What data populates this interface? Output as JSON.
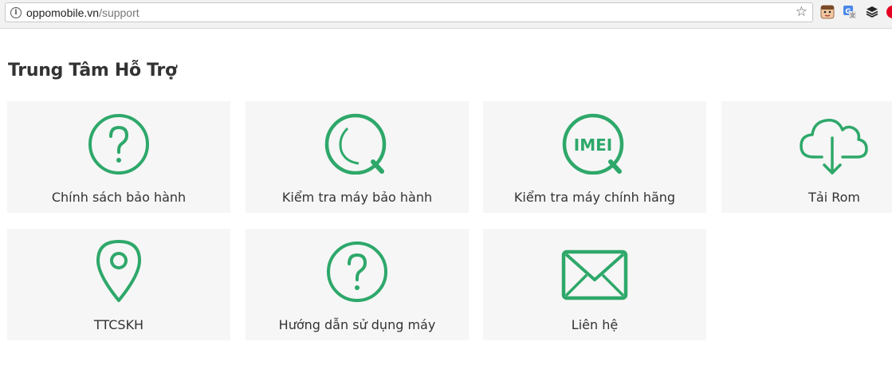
{
  "browser": {
    "url_domain": "oppomobile.vn",
    "url_path": "/support",
    "info_glyph": "i",
    "star_glyph": "☆"
  },
  "page": {
    "title": "Trung Tâm Hỗ Trợ"
  },
  "colors": {
    "accent": "#2ea86a",
    "card_bg": "#f6f6f6",
    "text": "#333333"
  },
  "cards": [
    {
      "label": "Chính sách bảo hành",
      "icon": "question-circle-icon"
    },
    {
      "label": "Kiểm tra máy bảo hành",
      "icon": "search-q-icon"
    },
    {
      "label": "Kiểm tra máy chính hãng",
      "icon": "imei-search-icon",
      "icon_text": "IMEI"
    },
    {
      "label": "Tải Rom",
      "icon": "cloud-download-icon"
    },
    {
      "label": "TTCSKH",
      "icon": "map-pin-icon"
    },
    {
      "label": "Hướng dẫn sử dụng máy",
      "icon": "question-circle-icon"
    },
    {
      "label": "Liên hệ",
      "icon": "envelope-icon"
    }
  ]
}
